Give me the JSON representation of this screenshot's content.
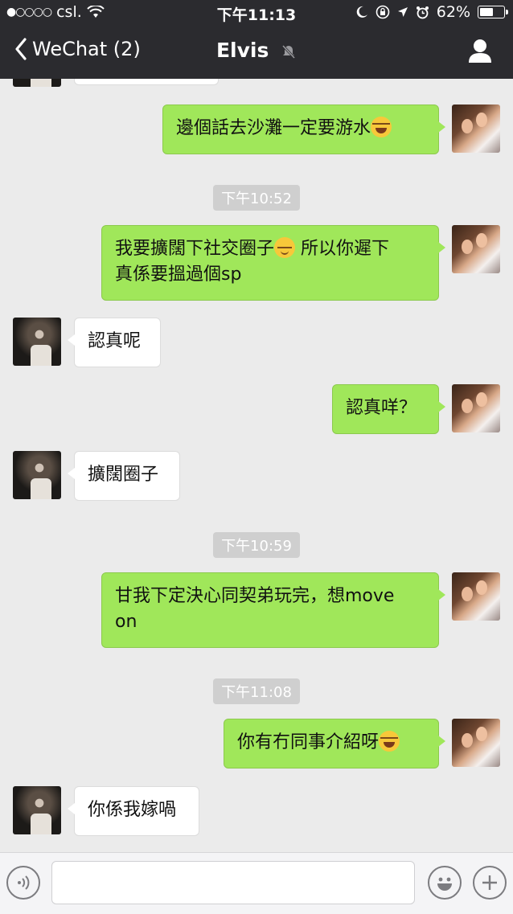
{
  "status_bar": {
    "carrier": "csl.",
    "time": "下午11:13",
    "battery": "62%",
    "battery_level": 0.62
  },
  "nav": {
    "back_label": "WeChat (2)",
    "title": "Elvis",
    "icons": [
      "chevron-left-icon",
      "mute-bell-icon",
      "profile-icon"
    ]
  },
  "messages": [
    {
      "sender": "me",
      "text": "邊個話去沙灘一定要游水",
      "emoji": "laugh"
    },
    {
      "type": "time",
      "text": "下午10:52"
    },
    {
      "sender": "me",
      "line1": "我要擴闊下社交圈子",
      "emoji": "relieved",
      "line1b": " 所以你遲下",
      "line2": "真係要搵過個sp"
    },
    {
      "sender": "Elvis",
      "text": "認真呢"
    },
    {
      "sender": "me",
      "text": "認真咩？"
    },
    {
      "sender": "Elvis",
      "text": "擴闊圈子"
    },
    {
      "type": "time",
      "text": "下午10:59"
    },
    {
      "sender": "me",
      "line1": "甘我下定決心同契弟玩完，想move",
      "line2": "on"
    },
    {
      "type": "time",
      "text": "下午11:08"
    },
    {
      "sender": "me",
      "text": "你有冇同事介紹呀",
      "emoji": "laugh"
    },
    {
      "sender": "Elvis",
      "text": "你係我嫁喎"
    }
  ],
  "input_bar": {
    "value": "",
    "icons": [
      "voice-icon",
      "emoji-icon",
      "add-icon"
    ]
  },
  "colors": {
    "bar": "#2b2b2f",
    "my_bubble": "#a0e75a",
    "their_bubble": "#ffffff",
    "chat_bg": "#ebebeb"
  }
}
